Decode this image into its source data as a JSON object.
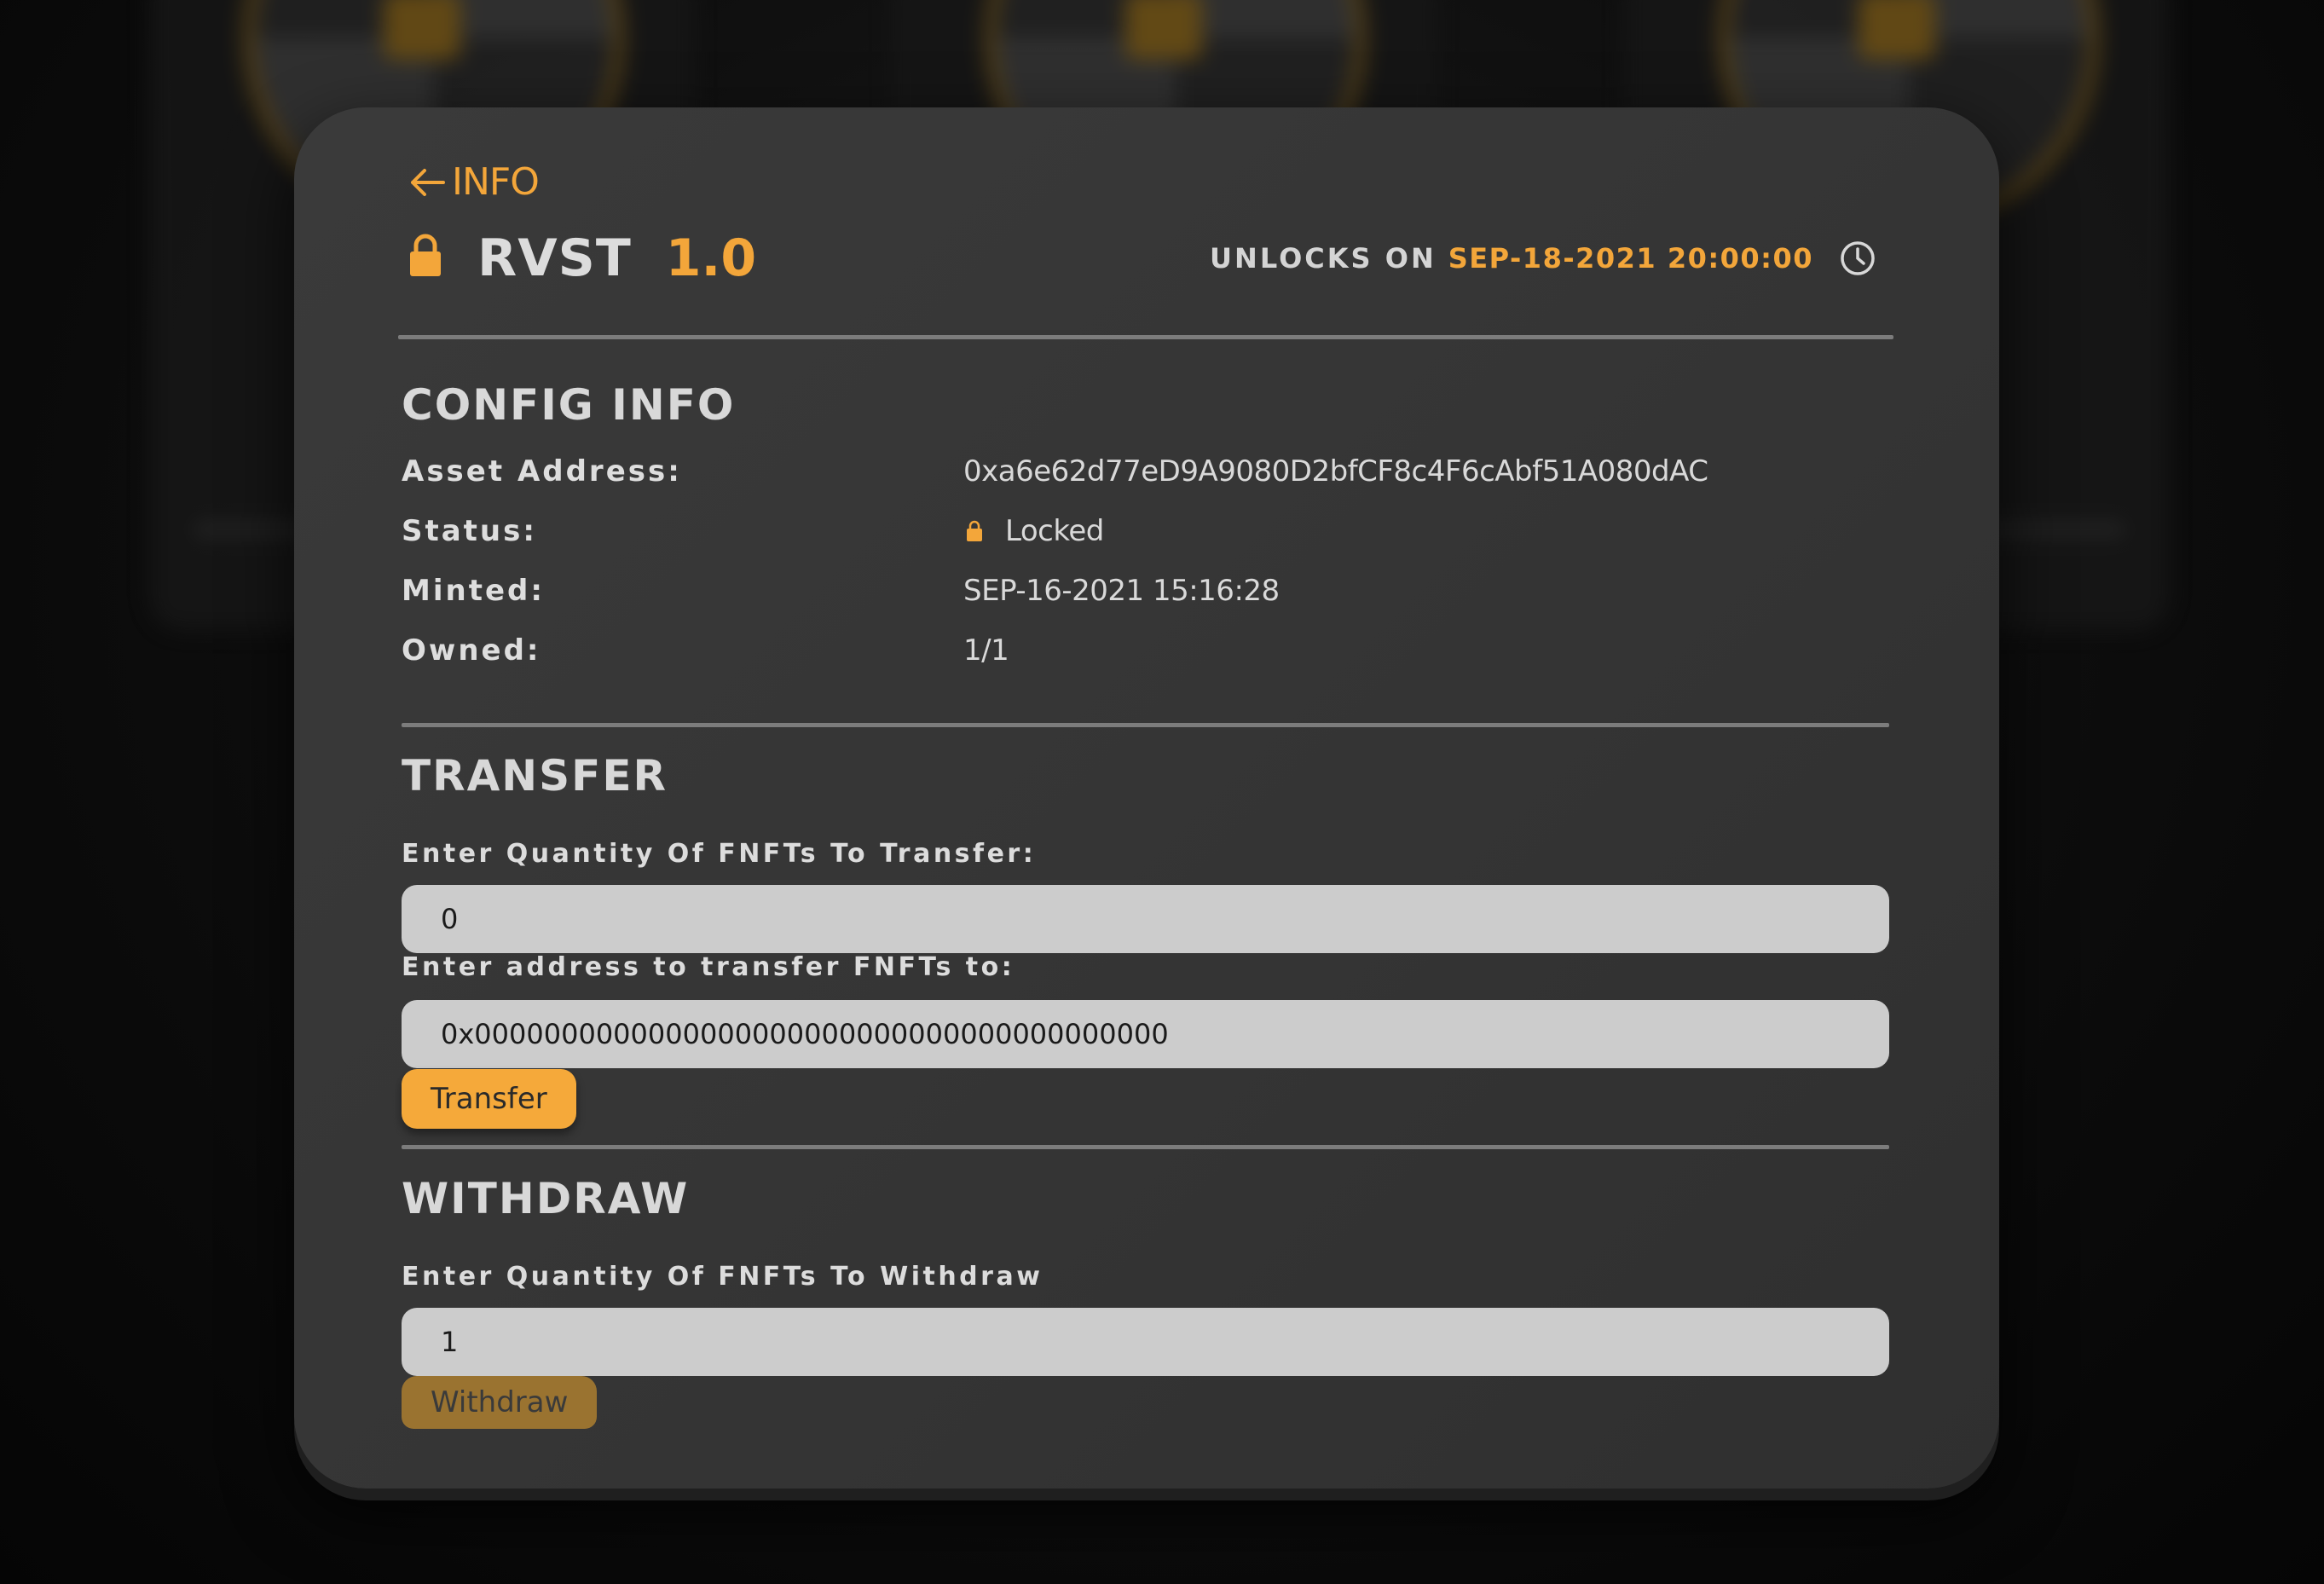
{
  "nav": {
    "back_label": "INFO"
  },
  "token": {
    "name": "RVST",
    "version": "1.0"
  },
  "unlock": {
    "label": "UNLOCKS ON",
    "date": "SEP-18-2021 20:00:00"
  },
  "config": {
    "title": "CONFIG INFO",
    "rows": [
      {
        "label": "Asset Address:",
        "value": "0xa6e62d77eD9A9080D2bfCF8c4F6cAbf51A080dAC"
      },
      {
        "label": "Status:",
        "value": "Locked"
      },
      {
        "label": "Minted:",
        "value": "SEP-16-2021 15:16:28"
      },
      {
        "label": "Owned:",
        "value": "1/1"
      }
    ]
  },
  "transfer": {
    "title": "TRANSFER",
    "quantity_label": "Enter Quantity Of FNFTs To Transfer:",
    "quantity_value": "0",
    "address_label": "Enter address to transfer FNFTs to:",
    "address_value": "0x0000000000000000000000000000000000000000",
    "button_label": "Transfer"
  },
  "withdraw": {
    "title": "WITHDRAW",
    "quantity_label": "Enter Quantity Of FNFTs To Withdraw",
    "quantity_value": "1",
    "button_label": "Withdraw"
  },
  "icons": {
    "back": "arrow-left-icon",
    "lock": "lock-icon",
    "clock": "clock-icon",
    "status_lock": "lock-icon"
  },
  "colors": {
    "accent": "#f3a63a",
    "panel": "#383838",
    "input": "#cccccc",
    "withdraw_disabled": "#9a7330"
  }
}
